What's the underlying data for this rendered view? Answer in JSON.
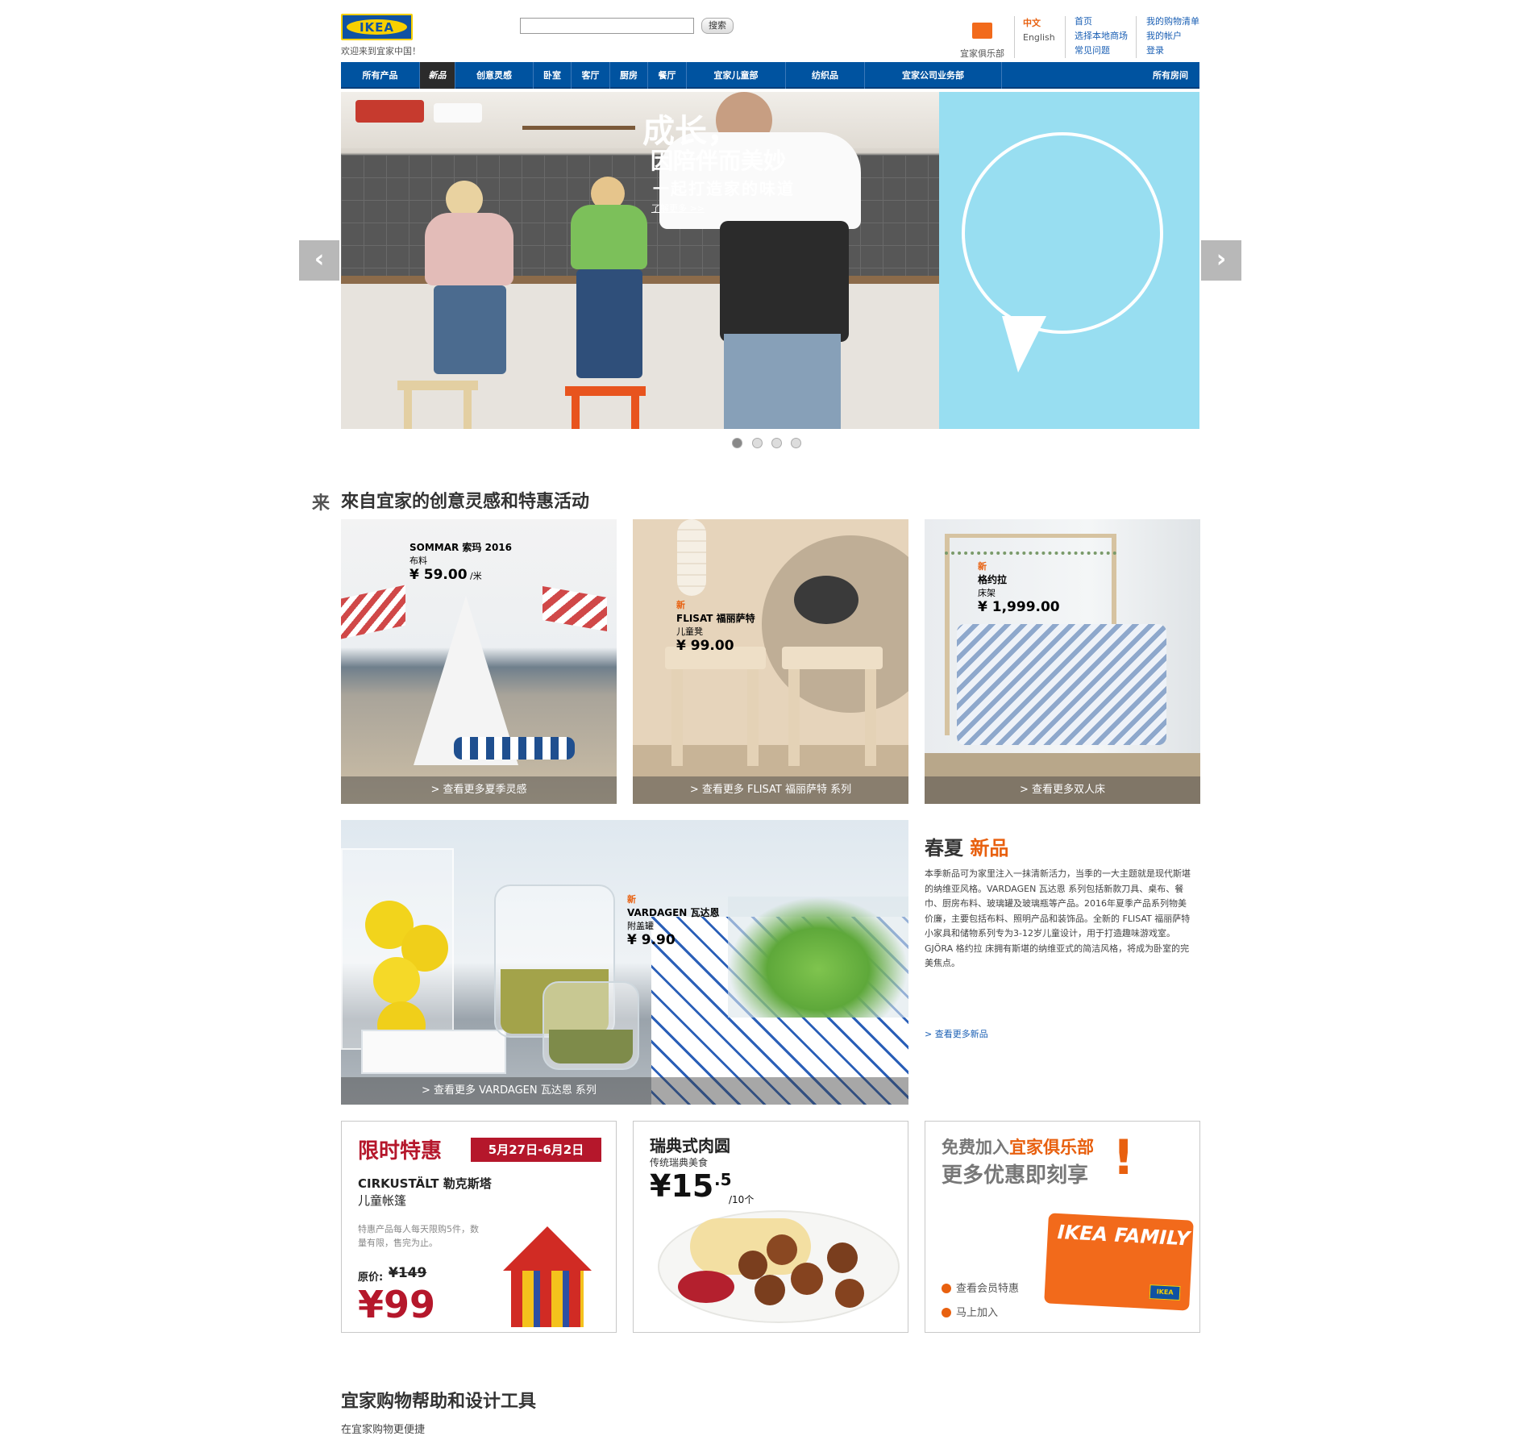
{
  "header": {
    "logo_text": "IKEA",
    "welcome": "欢迎来到宜家中国！",
    "search_button": "搜索",
    "club_label": "宜家俱乐部",
    "lang_zh": "中文",
    "lang_en": "English",
    "links_col1": [
      "首页",
      "选择本地商场",
      "常见问题"
    ],
    "links_col2": [
      "我的购物清单",
      "我的帐户",
      "登录"
    ]
  },
  "nav": {
    "items": [
      "所有产品",
      "新品",
      "创意灵感",
      "卧室",
      "客厅",
      "厨房",
      "餐厅",
      "宜家儿童部",
      "纺织品",
      "宜家公司业务部",
      "所有房间"
    ],
    "active": "新品"
  },
  "hero": {
    "line1": "成长，",
    "line2": "因陪伴而美妙",
    "line3": "一起打造家的味道",
    "more": "了解更多 >>",
    "prev": "‹",
    "next": "›",
    "dots": 4,
    "active_dot": 1
  },
  "section1": {
    "icon_char": "来",
    "title": "來自宜家的创意灵感和特惠活动"
  },
  "tiles": [
    {
      "new": "",
      "name": "SOMMAR 索玛 2016",
      "sub": "布料",
      "price": "¥ 59.00",
      "unit": "/米",
      "caption": "> 查看更多夏季灵感"
    },
    {
      "new": "新",
      "name": "FLISAT 福丽萨特",
      "sub": "儿童凳",
      "price": "¥ 99.00",
      "unit": "",
      "caption": "> 查看更多 FLISAT 福丽萨特 系列"
    },
    {
      "new": "新",
      "name": "格约拉",
      "sub": "床架",
      "price": "¥ 1,999.00",
      "unit": "",
      "caption": "> 查看更多双人床"
    },
    {
      "new": "新",
      "name": "VARDAGEN 瓦达恩",
      "sub": "附盖罐",
      "price": "¥ 9.90",
      "unit": "",
      "caption": "> 查看更多 VARDAGEN 瓦达恩 系列"
    }
  ],
  "spring": {
    "title_a": "春夏 ",
    "title_b": "新品",
    "body": "本季新品可为家里注入一抹清新活力，当季的一大主题就是现代斯堪的纳维亚风格。VARDAGEN 瓦达恩 系列包括新款刀具、桌布、餐巾、厨房布料、玻璃罐及玻璃瓶等产品。2016年夏季产品系列物美价廉，主要包括布料、照明产品和装饰品。全新的 FLISAT 福丽萨特 小家具和储物系列专为3-12岁儿童设计，用于打造趣味游戏室。GJÖRA 格约拉 床拥有斯堪的纳维亚式的简洁风格，将成为卧室的完美焦点。",
    "more": "> 查看更多新品"
  },
  "deal": {
    "title": "限时特惠",
    "date": "5月27日-6月2日",
    "name": "CIRKUSTÄLT 勒克斯塔",
    "sub": "儿童帐篷",
    "note": "特惠产品每人每天限购5件，数量有限，售完为止。",
    "orig_label": "原价:",
    "orig_price": "¥149",
    "price": "¥99"
  },
  "meatball": {
    "title": "瑞典式肉圆",
    "sub": "传统瑞典美食",
    "price_main": "¥15",
    "price_dec": ".5",
    "unit": "/10个"
  },
  "family": {
    "line1_a": "免费加入",
    "line1_b": "宜家俱乐部",
    "line2": "更多优惠即刻享",
    "bang": "!",
    "card_text": "IKEA FAMILY",
    "card_logo": "IKEA",
    "link1": "查看会员特惠",
    "link2": "马上加入"
  },
  "help": {
    "title": "宜家购物帮助和设计工具",
    "sub": "在宜家购物更便捷"
  },
  "colors": {
    "nav_blue": "#0053a0",
    "ikea_yellow": "#f8d000",
    "accent_orange": "#e8600f",
    "deal_red": "#b5172b",
    "hero_sky": "#98def1"
  }
}
